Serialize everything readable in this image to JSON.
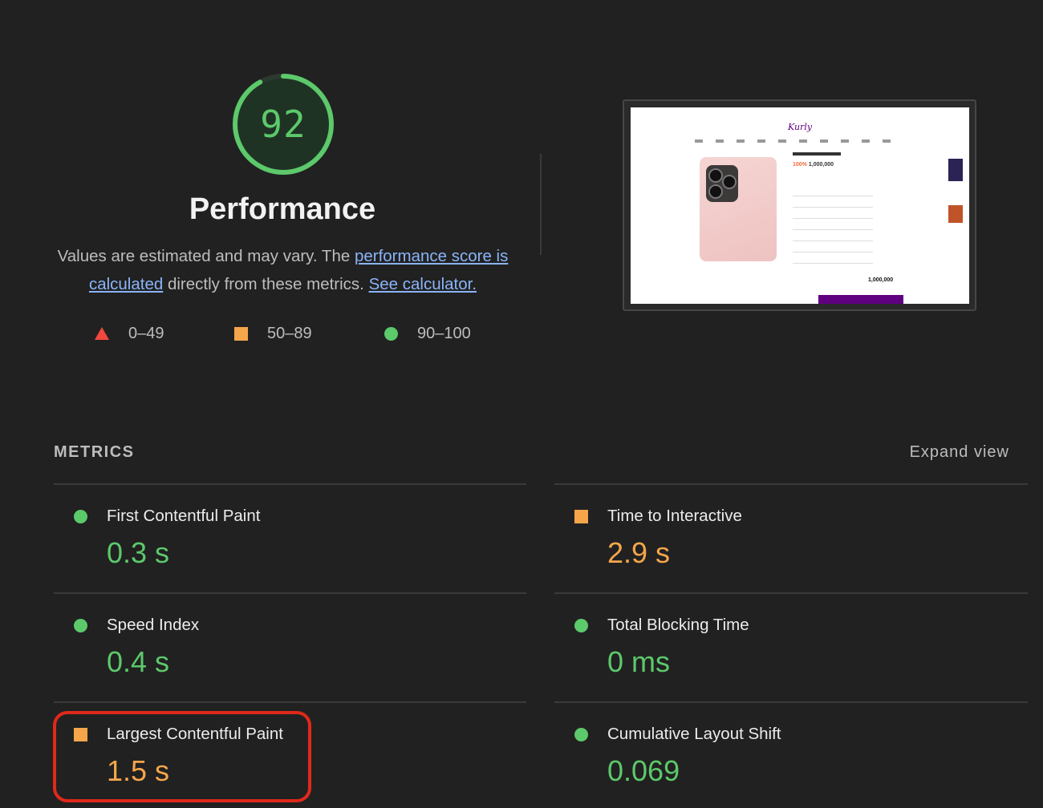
{
  "gauge": {
    "score": "92",
    "score_fraction": 0.92,
    "label": "Performance",
    "color": "#5cc96b"
  },
  "description": {
    "text1": "Values are estimated and may vary. The ",
    "link1": "performance score is calculated",
    "text2": " directly from these metrics. ",
    "link2": "See calculator."
  },
  "legend": [
    {
      "icon": "triangle-fail-icon",
      "range": "0–49",
      "color": "#f2473f"
    },
    {
      "icon": "square-average-icon",
      "range": "50–89",
      "color": "#f5a64b"
    },
    {
      "icon": "circle-pass-icon",
      "range": "90–100",
      "color": "#5cc96b"
    }
  ],
  "thumbnail": {
    "logo": "Kurly",
    "price_discount": "100%",
    "price": "1,000,000",
    "total": "1,000,000"
  },
  "metrics": {
    "header": "METRICS",
    "expand_label": "Expand view",
    "items": [
      {
        "label": "First Contentful Paint",
        "value": "0.3 s",
        "status": "pass"
      },
      {
        "label": "Time to Interactive",
        "value": "2.9 s",
        "status": "average"
      },
      {
        "label": "Speed Index",
        "value": "0.4 s",
        "status": "pass"
      },
      {
        "label": "Total Blocking Time",
        "value": "0 ms",
        "status": "pass"
      },
      {
        "label": "Largest Contentful Paint",
        "value": "1.5 s",
        "status": "average"
      },
      {
        "label": "Cumulative Layout Shift",
        "value": "0.069",
        "status": "pass"
      }
    ]
  },
  "colors": {
    "pass": "#5cc96b",
    "average": "#f5a64b",
    "fail": "#f2473f",
    "highlight": "#e0291b"
  }
}
